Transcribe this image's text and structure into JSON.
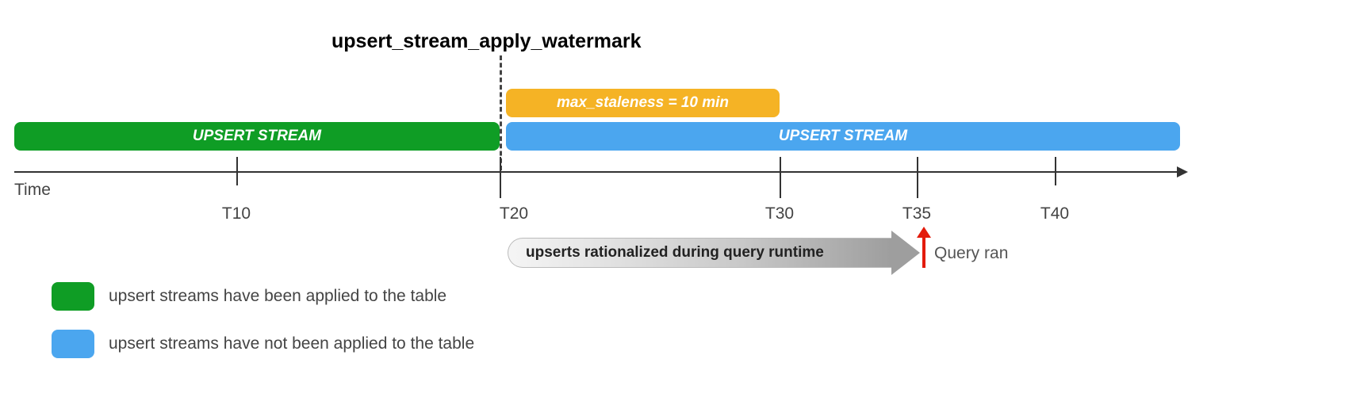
{
  "title": "upsert_stream_apply_watermark",
  "bars": {
    "staleness": "max_staleness = 10 min",
    "green_stream": "UPSERT STREAM",
    "blue_stream": "UPSERT STREAM"
  },
  "axis": {
    "label": "Time",
    "ticks": [
      "T10",
      "T20",
      "T30",
      "T35",
      "T40"
    ]
  },
  "rationalized": "upserts rationalized during query runtime",
  "query_label": "Query ran",
  "legend": {
    "green": "upsert streams have been applied to the table",
    "blue": "upsert streams have not been applied to the table"
  },
  "chart_data": {
    "type": "timeline",
    "time_axis_range": [
      0,
      45
    ],
    "watermark": {
      "position": 20,
      "label": "upsert_stream_apply_watermark"
    },
    "segments": [
      {
        "name": "applied_upsert_stream",
        "color": "#0f9d25",
        "start": 0,
        "end": 20,
        "label": "UPSERT STREAM",
        "description": "upsert streams have been applied to the table"
      },
      {
        "name": "unapplied_upsert_stream",
        "color": "#4ba6ef",
        "start": 20,
        "end": 45,
        "label": "UPSERT STREAM",
        "description": "upsert streams have not been applied to the table"
      },
      {
        "name": "max_staleness_window",
        "color": "#f5b325",
        "start": 20,
        "end": 30,
        "label": "max_staleness = 10 min"
      }
    ],
    "annotations": [
      {
        "name": "rationalized_range",
        "start": 20,
        "end": 35,
        "label": "upserts rationalized during query runtime"
      },
      {
        "name": "query_event",
        "position": 35,
        "label": "Query ran"
      }
    ],
    "ticks": [
      10,
      20,
      30,
      35,
      40
    ]
  }
}
